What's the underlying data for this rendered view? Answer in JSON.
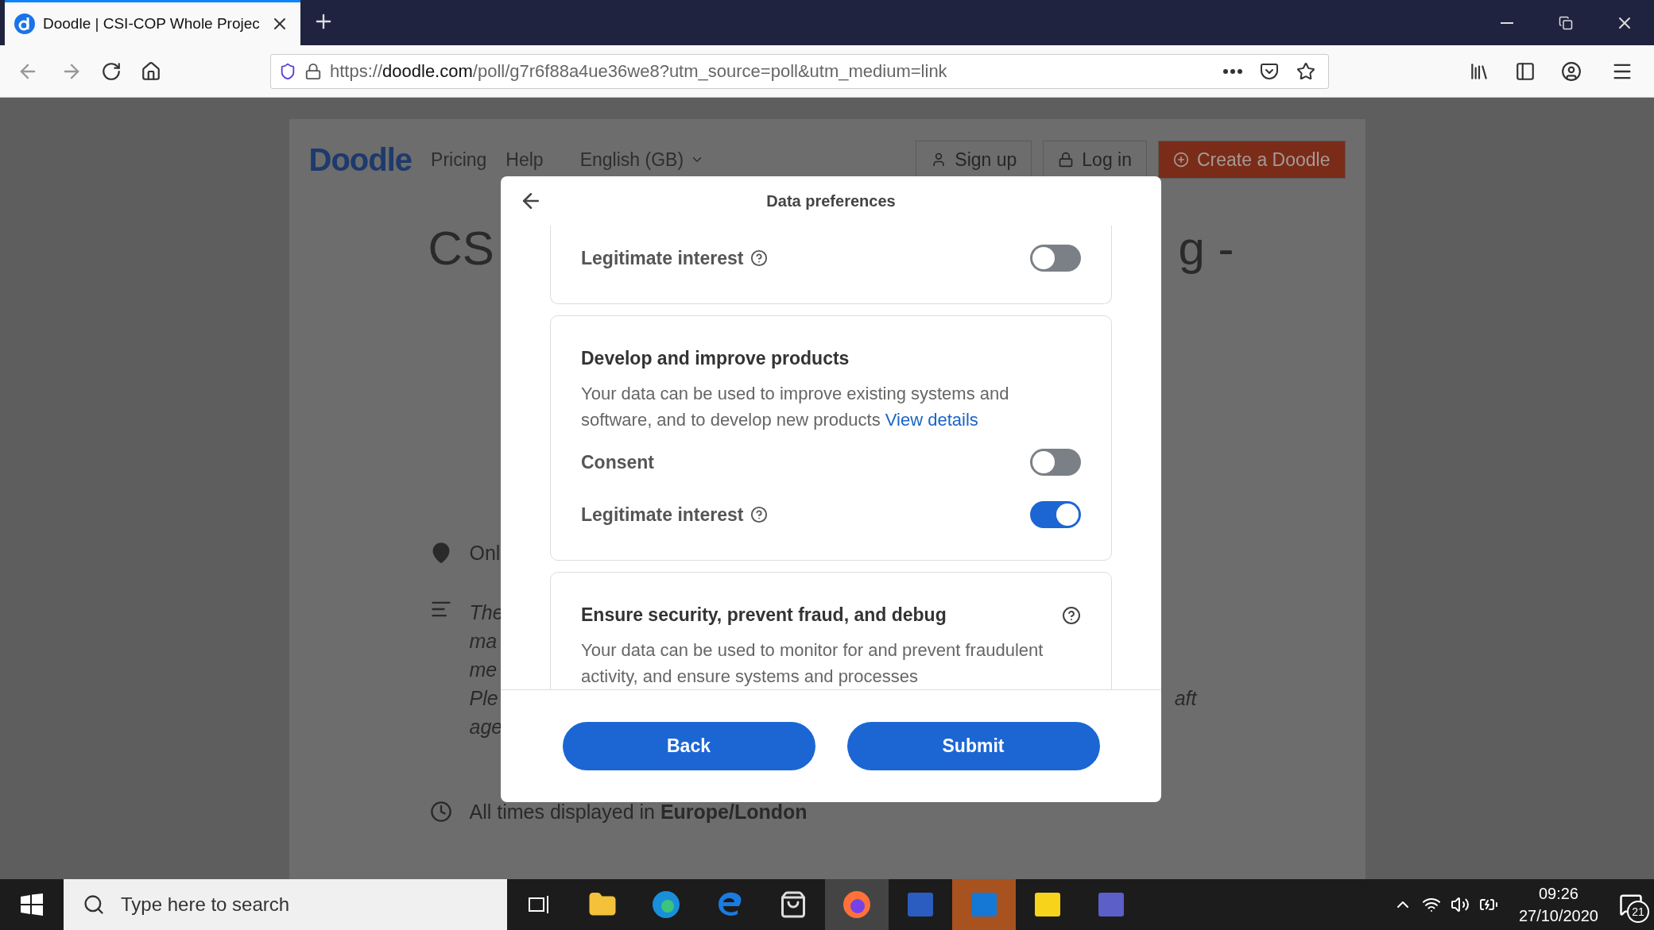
{
  "browser": {
    "tab_title": "Doodle | CSI-COP Whole Projec",
    "url_host": "doodle.com",
    "url_scheme": "https://",
    "url_path": "/poll/g7r6f88a4ue36we8?utm_source=poll&utm_medium=link"
  },
  "page": {
    "logo": "Doodle",
    "nav": [
      "Pricing",
      "Help"
    ],
    "language": "English (GB)",
    "sign_up": "Sign up",
    "log_in": "Log in",
    "create": "Create a Doodle",
    "title_left": "CS",
    "title_right": "g -",
    "location": "Onl",
    "description_lines": [
      "The",
      "ma",
      "me",
      "Ple",
      "age"
    ],
    "description_right": "aft",
    "timezone": "All times displayed in **Europe/London**"
  },
  "modal": {
    "title": "Data preferences",
    "sections": [
      {
        "cut_top": true,
        "toggles": [
          {
            "label": "Legitimate interest",
            "help": true,
            "on": false
          }
        ]
      },
      {
        "cut_top": false,
        "heading": "Develop and improve products",
        "text": "Your data can be used to improve existing systems and software, and to develop new products",
        "link": "View details",
        "help": false,
        "toggles": [
          {
            "label": "Consent",
            "help": false,
            "on": false
          },
          {
            "label": "Legitimate interest",
            "help": true,
            "on": true
          }
        ]
      },
      {
        "cut_top": false,
        "heading": "Ensure security, prevent fraud, and debug",
        "text": "Your data can be used to monitor for and prevent fraudulent activity, and ensure systems and processes",
        "help": true
      }
    ],
    "buttons": [
      "Back",
      "Submit"
    ]
  },
  "taskbar": {
    "search_placeholder": "Type here to search",
    "time": "09:26",
    "date": "27/10/2020",
    "notifications": "21"
  }
}
